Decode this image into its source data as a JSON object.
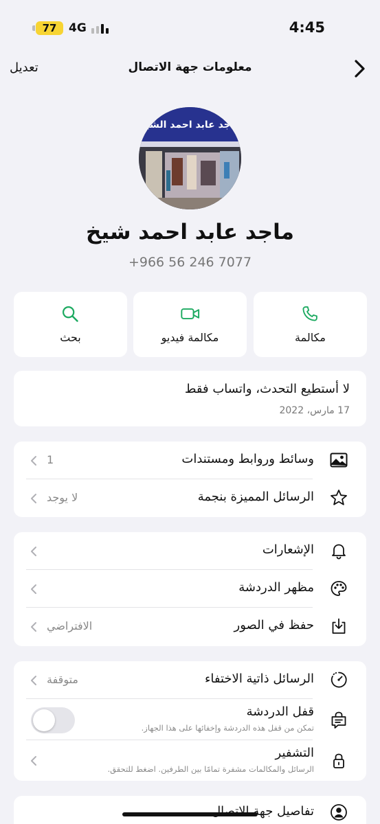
{
  "status_bar": {
    "battery": "77",
    "network": "4G",
    "time": "4:45"
  },
  "header": {
    "title": "معلومات جهة الاتصال",
    "edit_label": "تعديل",
    "back_icon": "chevron-right-icon"
  },
  "contact": {
    "name": "ماجد عابد احمد شيخ",
    "phone": "+966 56 246 7077",
    "avatar_sign_text": "ماجد عابد احمد الشيخ"
  },
  "actions": [
    {
      "label": "مكالمة",
      "icon": "phone-icon"
    },
    {
      "label": "مكالمة فيديو",
      "icon": "video-icon"
    },
    {
      "label": "بحث",
      "icon": "search-icon"
    }
  ],
  "about": {
    "text": "لا أستطيع التحدث، واتساب فقط",
    "date": "17 مارس، 2022"
  },
  "media_section": [
    {
      "label": "وسائط وروابط ومستندات",
      "value": "1",
      "icon": "image-icon"
    },
    {
      "label": "الرسائل المميزة بنجمة",
      "value": "لا يوجد",
      "icon": "star-icon"
    }
  ],
  "settings_section": [
    {
      "label": "الإشعارات",
      "value": "",
      "icon": "bell-icon"
    },
    {
      "label": "مظهر الدردشة",
      "value": "",
      "icon": "palette-icon"
    },
    {
      "label": "حفظ في الصور",
      "value": "الافتراضي",
      "icon": "save-download-icon"
    }
  ],
  "privacy_section": {
    "disappearing": {
      "label": "الرسائل ذاتية الاختفاء",
      "value": "متوقفة",
      "icon": "timer-icon"
    },
    "chat_lock": {
      "label": "قفل الدردشة",
      "sub": "تمكن من قفل هذه الدردشة وإخفائها على هذا الجهاز.",
      "toggle_on": false,
      "icon": "chat-lock-icon"
    },
    "encryption": {
      "label": "التشفير",
      "sub": "الرسائل والمكالمات مشفرة تمامًا بين الطرفين. اضغط للتحقق.",
      "icon": "lock-icon"
    }
  },
  "details_section": {
    "label": "تفاصيل جهة الاتصال",
    "icon": "person-circle-icon"
  },
  "colors": {
    "accent_green": "#1daa61",
    "background": "#f2f2f7",
    "battery_yellow": "#f7d433"
  }
}
